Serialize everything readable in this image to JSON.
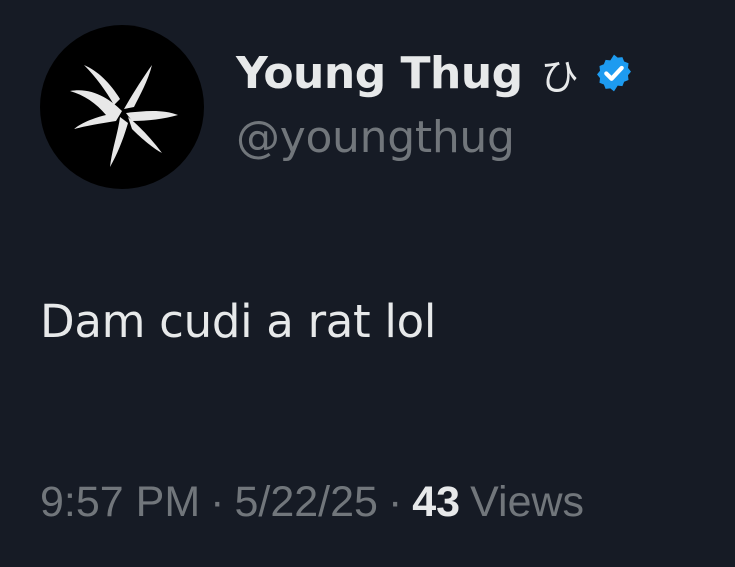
{
  "author": {
    "display_name": "Young Thug",
    "name_emoji": "ひ",
    "handle": "@youngthug",
    "verified_color": "#1d9bf0"
  },
  "tweet": {
    "text": "Dam cudi a rat lol"
  },
  "meta": {
    "time": "9:57 PM",
    "separator": "·",
    "date": "5/22/25",
    "views_count": "43",
    "views_label": "Views"
  }
}
